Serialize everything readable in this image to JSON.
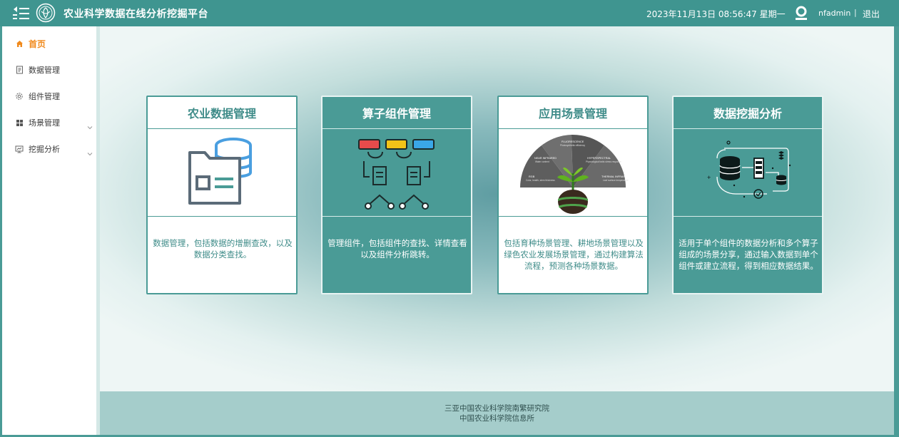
{
  "header": {
    "title": "农业科学数据在线分析挖掘平台",
    "datetime": "2023年11月13日 08:56:47 星期一",
    "username": "nfadmin",
    "separator": "|",
    "logout_label": "退出",
    "bar_color": "#3f9590"
  },
  "sidebar": {
    "items": [
      {
        "label": "首页",
        "icon": "home-icon",
        "active": true
      },
      {
        "label": "数据管理",
        "icon": "document-icon"
      },
      {
        "label": "组件管理",
        "icon": "gear-icon"
      },
      {
        "label": "场景管理",
        "icon": "grid-icon",
        "expandable": true
      },
      {
        "label": "挖掘分析",
        "icon": "chart-icon",
        "expandable": true
      }
    ],
    "active_color": "#f08a1d"
  },
  "cards": [
    {
      "title": "农业数据管理",
      "description": "数据管理，包括数据的增删查改，以及数据分类查找。",
      "style": "light"
    },
    {
      "title": "算子组件管理",
      "description": "管理组件，包括组件的查找、详情查看以及组件分析跳转。",
      "style": "dark"
    },
    {
      "title": "应用场景管理",
      "description": "包括育种场景管理、耕地场景管理以及绿色农业发展场景管理，通过构建算法流程，预测各种场景数据。",
      "style": "light"
    },
    {
      "title": "数据挖掘分析",
      "description": "适用于单个组件的数据分析和多个算子组成的场景分享，通过输入数据到单个组件或建立流程，得到相应数据结果。",
      "style": "dark"
    }
  ],
  "scene_image": {
    "segments": [
      "NEAR INFRARED",
      "FLUORESCENCE",
      "HYPERSPECTRAL",
      "THERMAL INFRARED",
      "RGB"
    ],
    "notes": [
      "Water content",
      "Photosynthetic efficiency",
      "Physiological traits stress response",
      "Leaf surface temperature",
      "Color, health, stem thickness"
    ]
  },
  "footer": {
    "line1": "三亚中国农业科学院南繁研究院",
    "line2": "中国农业科学院信息所"
  },
  "colors": {
    "teal": "#4a9b96",
    "footer": "#a5cdcb"
  }
}
